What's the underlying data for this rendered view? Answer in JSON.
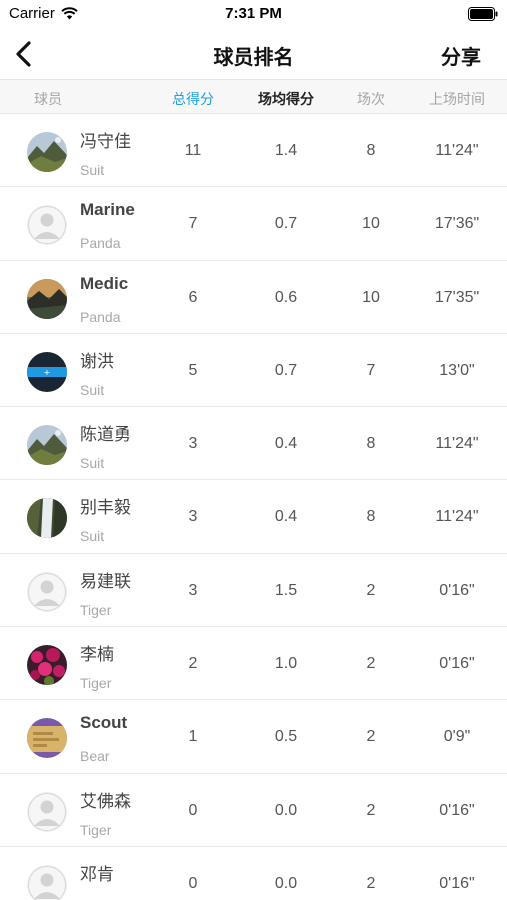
{
  "status_bar": {
    "carrier": "Carrier",
    "time": "7:31 PM"
  },
  "nav": {
    "title": "球员排名",
    "share_label": "分享"
  },
  "columns": {
    "player": "球员",
    "total": "总得分",
    "avg": "场均得分",
    "games": "场次",
    "time": "上场时间"
  },
  "colors": {
    "active_sort": "#1f9fe3",
    "separator": "#e9e9e9",
    "header_bg": "#f7f7f7"
  },
  "players": [
    {
      "name": "冯守佳",
      "team": "Suit",
      "total": "11",
      "avg": "1.4",
      "games": "8",
      "time": "11'24\"",
      "avatar": "mountain-photo"
    },
    {
      "name": "Marine",
      "team": "Panda",
      "total": "7",
      "avg": "0.7",
      "games": "10",
      "time": "17'36\"",
      "avatar": "default-user"
    },
    {
      "name": "Medic",
      "team": "Panda",
      "total": "6",
      "avg": "0.6",
      "games": "10",
      "time": "17'35\"",
      "avatar": "sunset-photo"
    },
    {
      "name": "谢洪",
      "team": "Suit",
      "total": "5",
      "avg": "0.7",
      "games": "7",
      "time": "13'0\"",
      "avatar": "blue-screen"
    },
    {
      "name": "陈道勇",
      "team": "Suit",
      "total": "3",
      "avg": "0.4",
      "games": "8",
      "time": "11'24\"",
      "avatar": "mountain-photo"
    },
    {
      "name": "别丰毅",
      "team": "Suit",
      "total": "3",
      "avg": "0.4",
      "games": "8",
      "time": "11'24\"",
      "avatar": "waterfall-photo"
    },
    {
      "name": "易建联",
      "team": "Tiger",
      "total": "3",
      "avg": "1.5",
      "games": "2",
      "time": "0'16\"",
      "avatar": "default-user"
    },
    {
      "name": "李楠",
      "team": "Tiger",
      "total": "2",
      "avg": "1.0",
      "games": "2",
      "time": "0'16\"",
      "avatar": "flowers-photo"
    },
    {
      "name": "Scout",
      "team": "Bear",
      "total": "1",
      "avg": "0.5",
      "games": "2",
      "time": "0'9\"",
      "avatar": "card-photo"
    },
    {
      "name": "艾佛森",
      "team": "Tiger",
      "total": "0",
      "avg": "0.0",
      "games": "2",
      "time": "0'16\"",
      "avatar": "default-user"
    },
    {
      "name": "邓肯",
      "team": "",
      "total": "0",
      "avg": "0.0",
      "games": "2",
      "time": "0'16\"",
      "avatar": "default-user"
    }
  ]
}
